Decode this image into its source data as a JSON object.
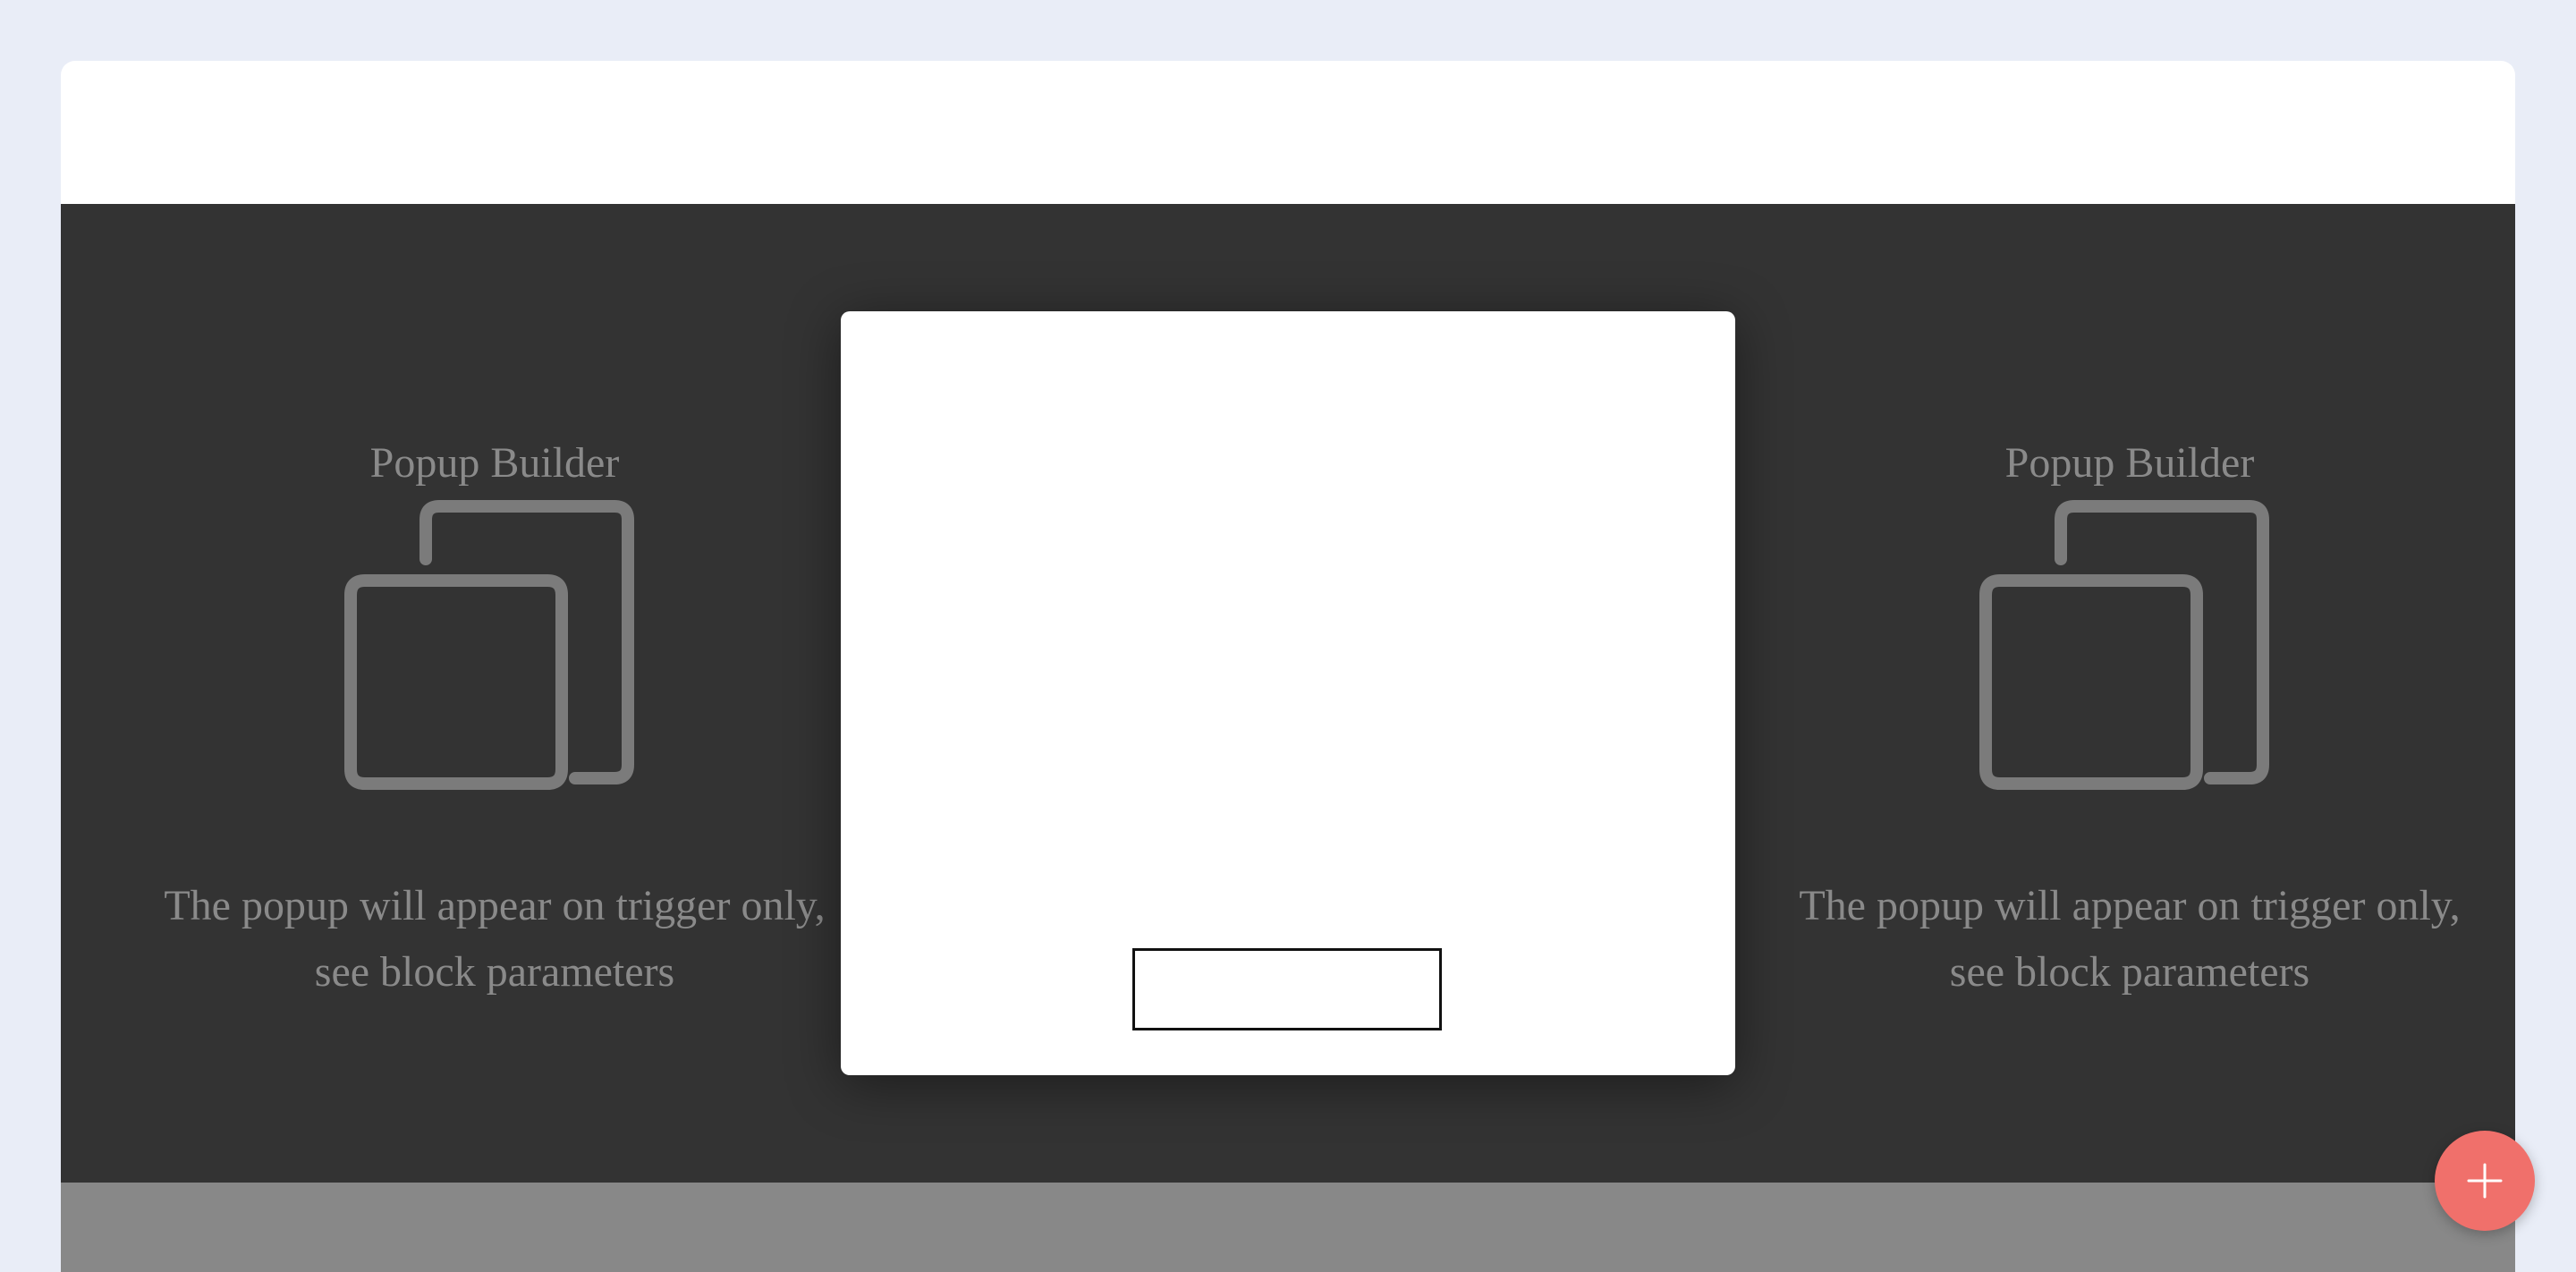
{
  "builder": {
    "placeholders": [
      {
        "title": "Popup Builder",
        "description": "The popup will appear on trigger only, see block parameters",
        "icon": "popup-layers-icon"
      },
      {
        "title": "Popup Builder",
        "description": "The popup will appear on trigger only, see block parameters",
        "icon": "popup-layers-icon"
      }
    ],
    "popup": {
      "button_label": ""
    }
  },
  "fab": {
    "icon": "plus-icon",
    "color": "#f0706b"
  },
  "colors": {
    "page_background": "#e9edf7",
    "dark_section": "#333333",
    "grey_section": "#888888",
    "placeholder_text": "#8a8a8a"
  }
}
